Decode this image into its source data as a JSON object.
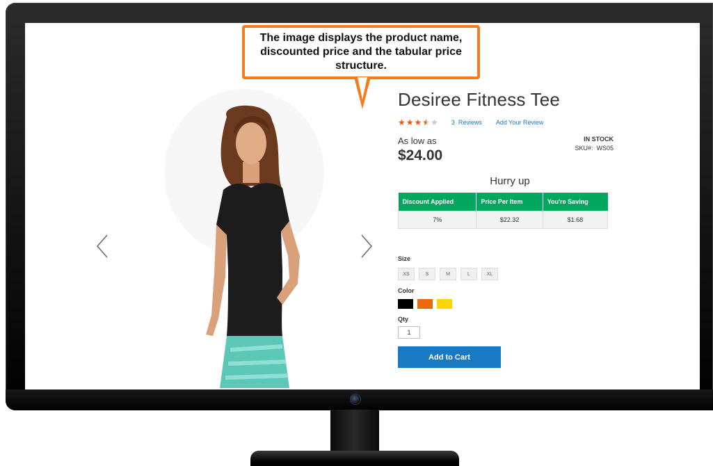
{
  "callout": {
    "text": "The image displays the product name, discounted price and the tabular price structure."
  },
  "gallery": {
    "prev_icon": "chevron-left-icon",
    "next_icon": "chevron-right-icon"
  },
  "product": {
    "name": "Desiree Fitness Tee",
    "rating": {
      "stars_filled": 3.5,
      "stars_total": 5,
      "reviews_link": "3  Reviews",
      "add_review_link": "Add Your Review"
    },
    "price_prefix": "As low as",
    "price": "$24.00",
    "stock_status": "IN STOCK",
    "sku_label": "SKU#:",
    "sku": "WS05",
    "hurry_text": "Hurry up",
    "tier_table": {
      "headers": [
        "Discount Applied",
        "Price Per Item",
        "You're Saving"
      ],
      "rows": [
        [
          "7%",
          "$22.32",
          "$1.68"
        ]
      ]
    },
    "size_label": "Size",
    "sizes": [
      "XS",
      "S",
      "M",
      "L",
      "XL"
    ],
    "color_label": "Color",
    "colors": [
      "#000000",
      "#eb6a0f",
      "#ffd500"
    ],
    "qty_label": "Qty",
    "qty_value": "1",
    "add_to_cart": "Add to Cart"
  },
  "theme": {
    "accent_orange": "#f47b20",
    "table_green": "#00a85e",
    "button_blue": "#1979c3",
    "star_orange": "#ff5501"
  }
}
